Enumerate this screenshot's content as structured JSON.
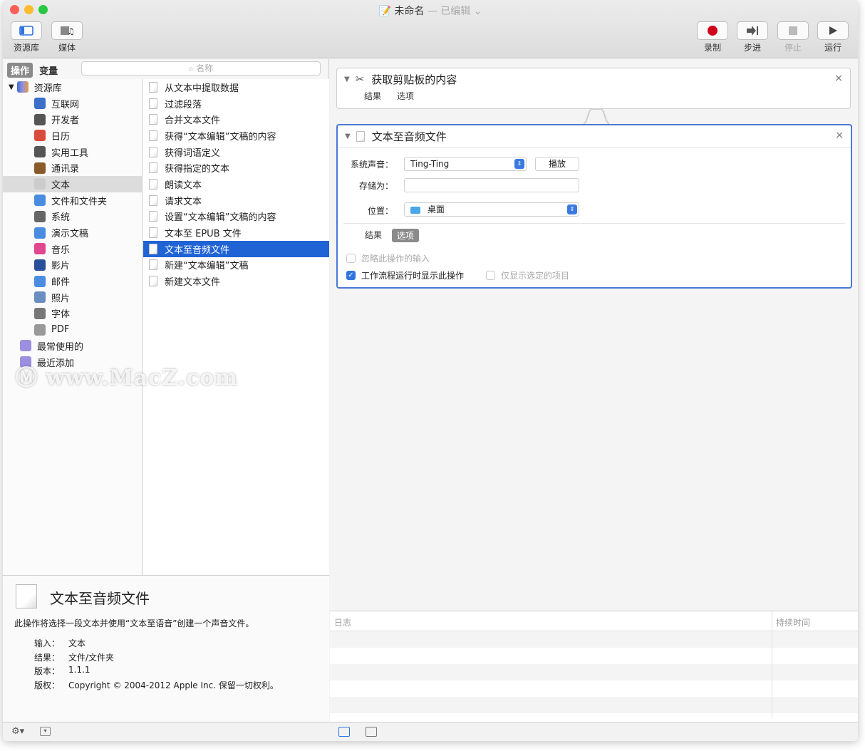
{
  "window": {
    "title": "未命名",
    "subtitle": "— 已编辑",
    "title_chevron": "⌄"
  },
  "toolbar": {
    "left": [
      {
        "label": "资源库",
        "icon": "library-icon"
      },
      {
        "label": "媒体",
        "icon": "media-icon"
      }
    ],
    "right": [
      {
        "label": "录制",
        "icon": "record-icon",
        "disabled": false
      },
      {
        "label": "步进",
        "icon": "step-icon",
        "disabled": false
      },
      {
        "label": "停止",
        "icon": "stop-icon",
        "disabled": true
      },
      {
        "label": "运行",
        "icon": "run-icon",
        "disabled": false
      }
    ]
  },
  "sidebar_tabs": {
    "actions": "操作",
    "variables": "变量"
  },
  "search": {
    "placeholder": "名称",
    "icon": "search-icon"
  },
  "library": {
    "root": "资源库",
    "items": [
      {
        "label": "互联网",
        "icon": "globe-icon",
        "color": "#3b6fc8"
      },
      {
        "label": "开发者",
        "icon": "tools-icon",
        "color": "#555555"
      },
      {
        "label": "日历",
        "icon": "calendar-icon",
        "color": "#d84b3c"
      },
      {
        "label": "实用工具",
        "icon": "tools-icon",
        "color": "#555555"
      },
      {
        "label": "通讯录",
        "icon": "contacts-icon",
        "color": "#8a5a2b"
      },
      {
        "label": "文本",
        "icon": "text-icon",
        "color": "#cccccc",
        "selected": true
      },
      {
        "label": "文件和文件夹",
        "icon": "finder-icon",
        "color": "#4a8de0"
      },
      {
        "label": "系统",
        "icon": "system-icon",
        "color": "#666666"
      },
      {
        "label": "演示文稿",
        "icon": "presentation-icon",
        "color": "#4a8de0"
      },
      {
        "label": "音乐",
        "icon": "music-icon",
        "color": "#e0478f"
      },
      {
        "label": "影片",
        "icon": "movie-icon",
        "color": "#2a4f9a"
      },
      {
        "label": "邮件",
        "icon": "mail-icon",
        "color": "#4a8de0"
      },
      {
        "label": "照片",
        "icon": "photo-icon",
        "color": "#6a8ec0"
      },
      {
        "label": "字体",
        "icon": "font-icon",
        "color": "#777777"
      },
      {
        "label": "PDF",
        "icon": "pdf-icon",
        "color": "#999999"
      }
    ],
    "extra": [
      {
        "label": "最常使用的",
        "icon": "folder-icon",
        "color": "#9c8fe0"
      },
      {
        "label": "最近添加",
        "icon": "folder-icon",
        "color": "#9c8fe0"
      }
    ]
  },
  "actions": [
    {
      "label": "从文本中提取数据"
    },
    {
      "label": "过滤段落"
    },
    {
      "label": "合并文本文件"
    },
    {
      "label": "获得“文本编辑”文稿的内容"
    },
    {
      "label": "获得词语定义"
    },
    {
      "label": "获得指定的文本"
    },
    {
      "label": "朗读文本"
    },
    {
      "label": "请求文本"
    },
    {
      "label": "设置“文本编辑”文稿的内容"
    },
    {
      "label": "文本至 EPUB 文件"
    },
    {
      "label": "文本至音频文件",
      "selected": true
    },
    {
      "label": "新建“文本编辑”文稿"
    },
    {
      "label": "新建文本文件"
    }
  ],
  "description": {
    "title": "文本至音频文件",
    "text": "此操作将选择一段文本并使用“文本至语音”创建一个声音文件。",
    "fields": [
      {
        "k": "输入：",
        "v": "文本"
      },
      {
        "k": "结果：",
        "v": "文件/文件夹"
      },
      {
        "k": "版本：",
        "v": "1.1.1"
      },
      {
        "k": "版权：",
        "v": "Copyright © 2004-2012 Apple Inc. 保留一切权利。"
      }
    ]
  },
  "workflow": {
    "step1": {
      "title": "获取剪贴板的内容",
      "tab_result": "结果",
      "tab_options": "选项"
    },
    "step2": {
      "title": "文本至音频文件",
      "voice_label": "系统声音：",
      "voice_value": "Ting-Ting",
      "play": "播放",
      "save_label": "存储为：",
      "save_value": "",
      "where_label": "位置：",
      "where_value": "桌面",
      "tab_result": "结果",
      "tab_options": "选项",
      "ignore_input": "忽略此操作的输入",
      "show_when_run": "工作流程运行时显示此操作",
      "show_selected_only": "仅显示选定的项目"
    }
  },
  "log": {
    "col_log": "日志",
    "col_duration": "持续时间"
  },
  "watermark": "www.MacZ.com",
  "colors": {
    "selection": "#1f63d5",
    "active_border": "#4a78d6",
    "record": "#d0021b"
  }
}
